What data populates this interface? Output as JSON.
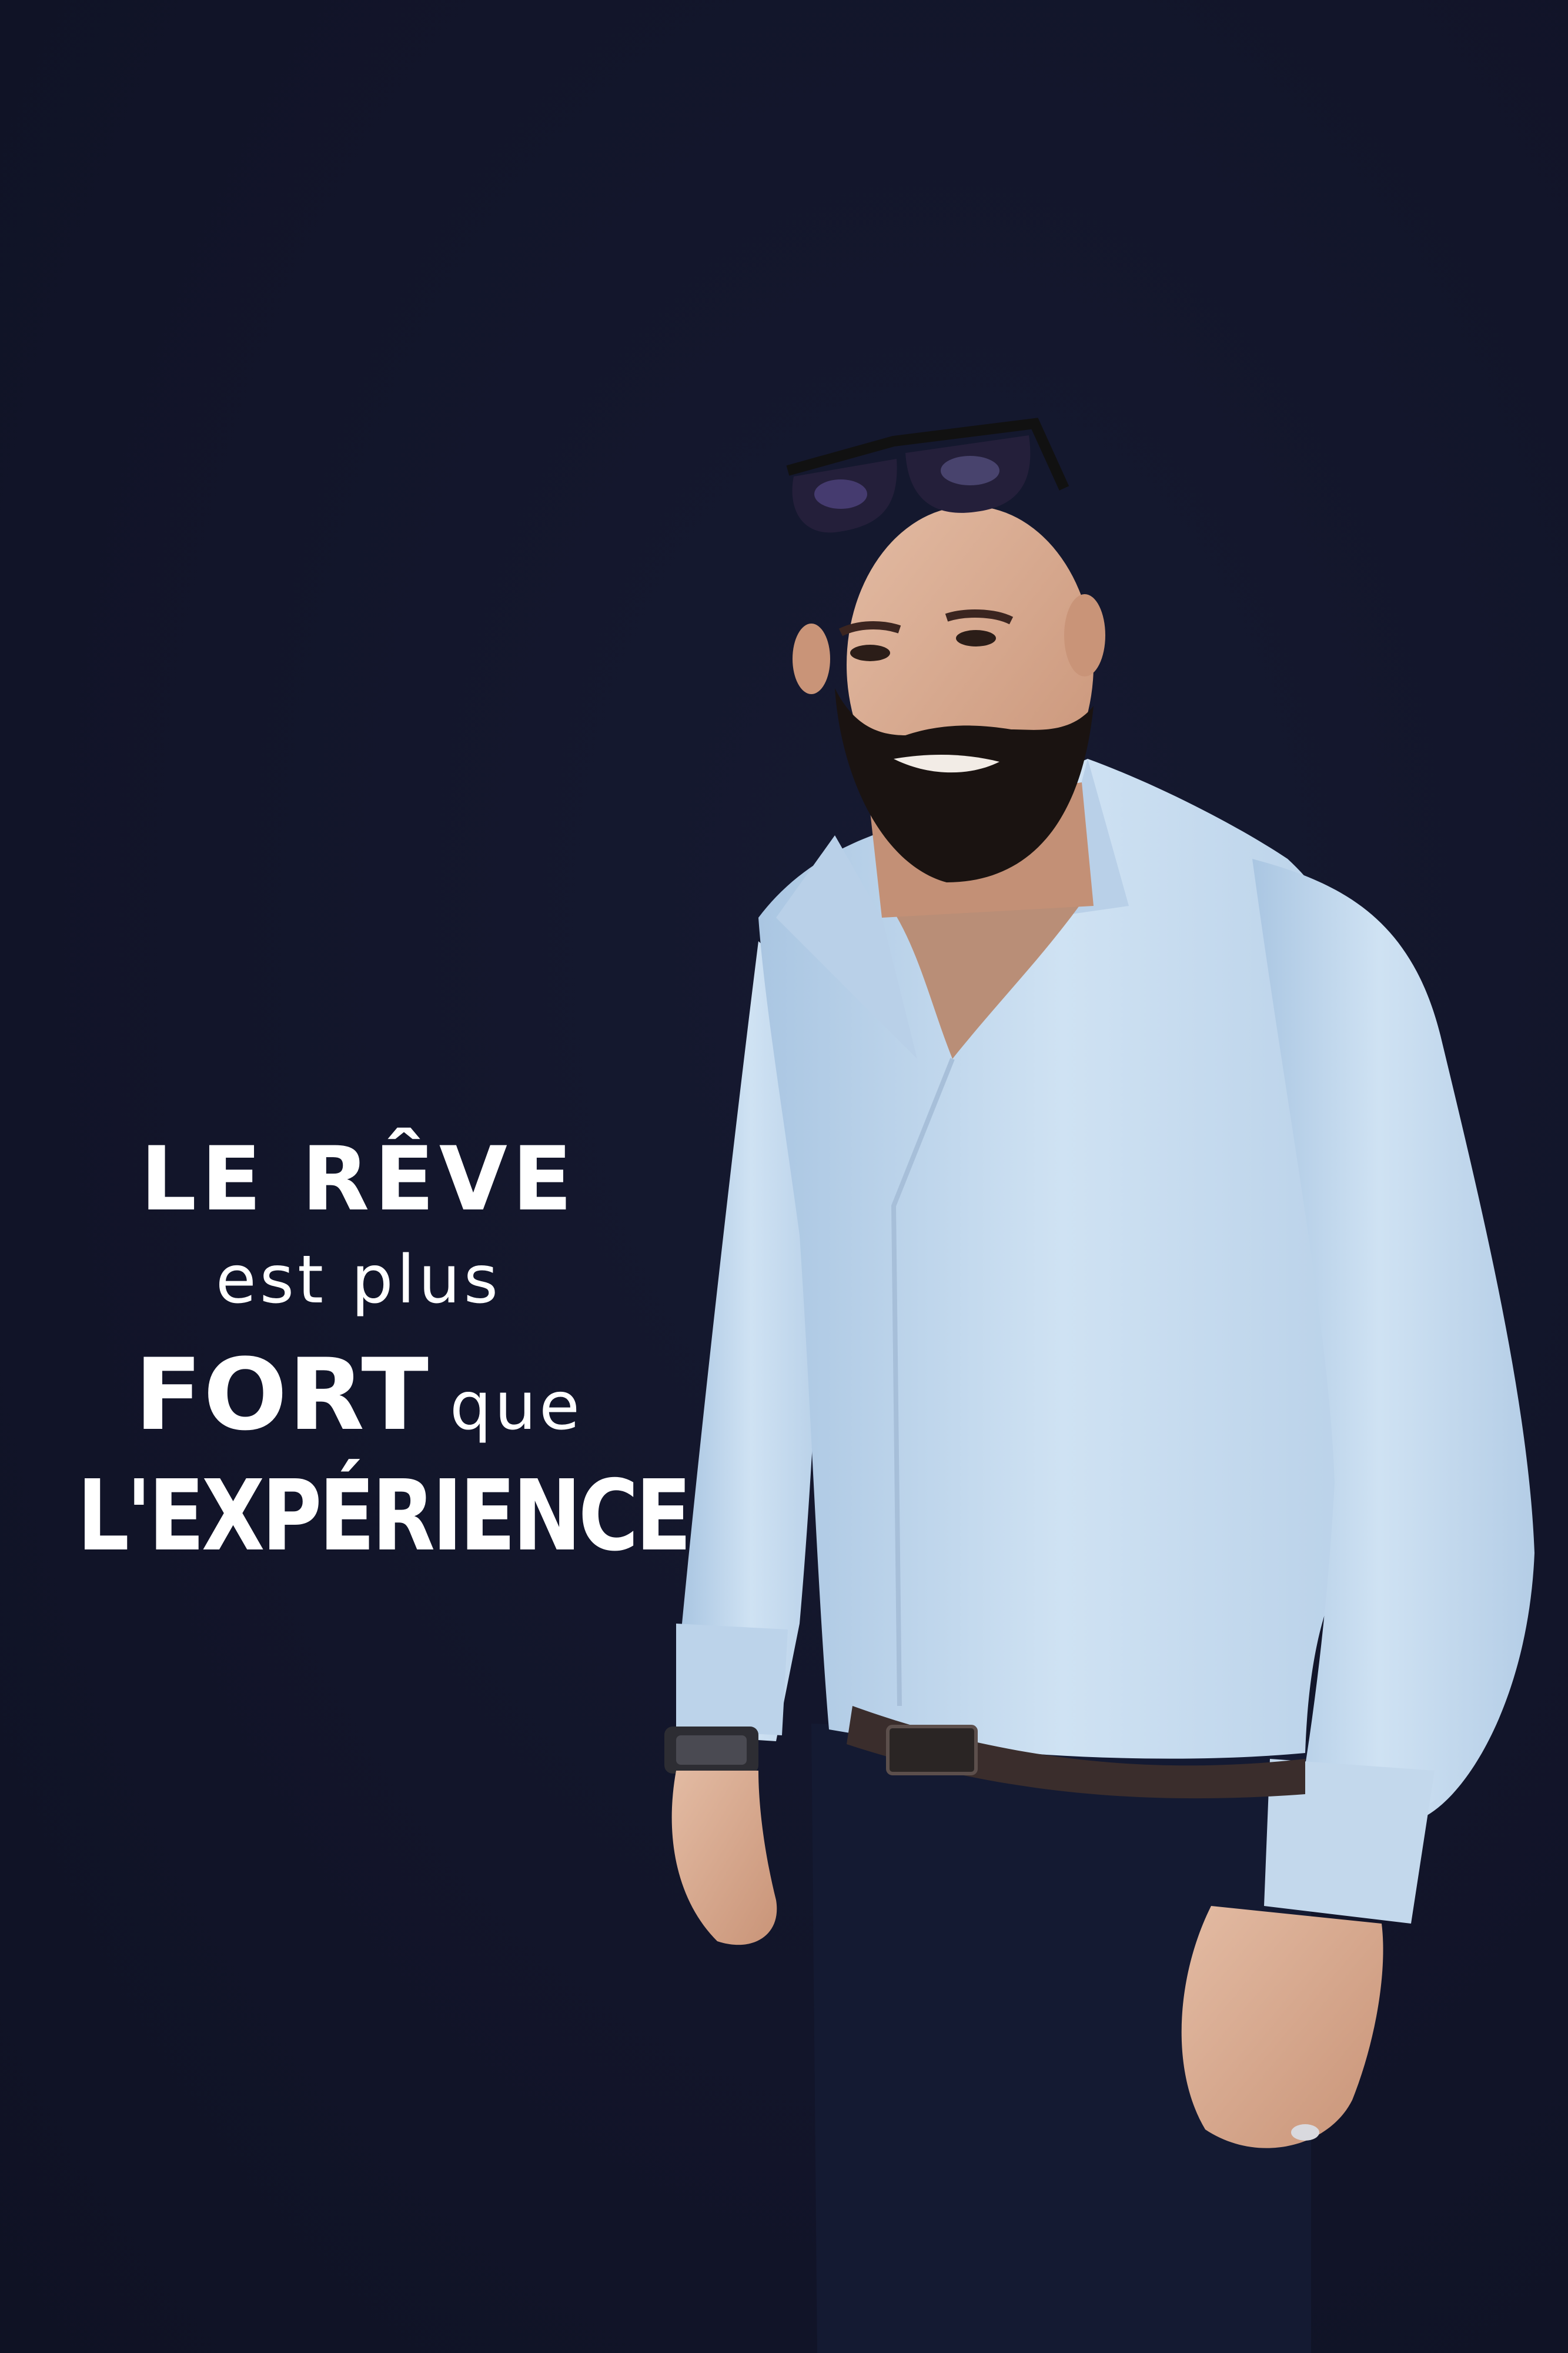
{
  "quote": {
    "line1": "LE RÊVE",
    "line2": "est plus",
    "line3_bold": "FORT",
    "line3_light": "que",
    "line4": "L'EXPÉRIENCE"
  },
  "colors": {
    "background": "#12152a",
    "text": "#ffffff",
    "shirt": "#c3d8ec",
    "trousers": "#141a32",
    "skin": "#d6a98e",
    "beard": "#1a1311"
  },
  "photo": {
    "subject": "bearded-man-in-light-blue-shirt-with-sunglasses-on-head"
  }
}
